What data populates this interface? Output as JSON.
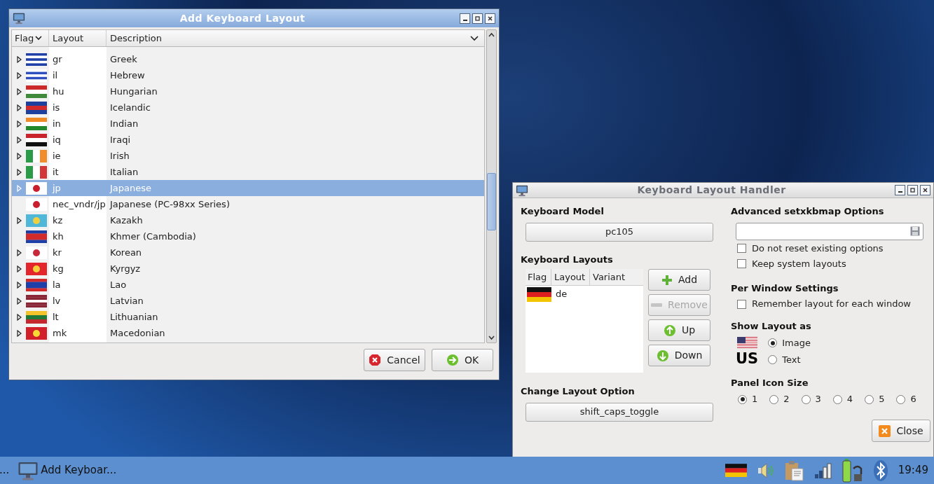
{
  "add_dialog": {
    "title": "Add Keyboard Layout",
    "columns": [
      "Flag",
      "Layout",
      "Description"
    ],
    "rows": [
      {
        "expandable": true,
        "selected": false,
        "layout": "gr",
        "description": "Greek",
        "flag": {
          "kind": "horizontal",
          "stripes": [
            {
              "color": "#1f3fa8"
            },
            {
              "color": "#ffffff"
            },
            {
              "color": "#1f3fa8"
            },
            {
              "color": "#ffffff"
            },
            {
              "color": "#1f3fa8"
            }
          ]
        }
      },
      {
        "expandable": true,
        "selected": false,
        "layout": "il",
        "description": "Hebrew",
        "flag": {
          "kind": "horizontal",
          "stripes": [
            {
              "color": "#ffffff"
            },
            {
              "color": "#2e4fbf"
            },
            {
              "color": "#ffffff"
            },
            {
              "color": "#2e4fbf"
            },
            {
              "color": "#ffffff"
            }
          ]
        }
      },
      {
        "expandable": true,
        "selected": false,
        "layout": "hu",
        "description": "Hungarian",
        "flag": {
          "kind": "horizontal",
          "stripes": [
            {
              "color": "#cc2a2a"
            },
            {
              "color": "#ffffff"
            },
            {
              "color": "#3f8a3a"
            }
          ]
        }
      },
      {
        "expandable": true,
        "selected": false,
        "layout": "is",
        "description": "Icelandic",
        "flag": {
          "kind": "horizontal",
          "stripes": [
            {
              "color": "#1d3f9e"
            },
            {
              "color": "#d22a2a"
            },
            {
              "color": "#1d3f9e"
            }
          ]
        }
      },
      {
        "expandable": true,
        "selected": false,
        "layout": "in",
        "description": "Indian",
        "flag": {
          "kind": "horizontal",
          "stripes": [
            {
              "color": "#f08a24"
            },
            {
              "color": "#ffffff"
            },
            {
              "color": "#23872c"
            }
          ]
        }
      },
      {
        "expandable": true,
        "selected": false,
        "layout": "iq",
        "description": "Iraqi",
        "flag": {
          "kind": "horizontal",
          "stripes": [
            {
              "color": "#c9242b"
            },
            {
              "color": "#ffffff"
            },
            {
              "color": "#111111"
            }
          ]
        }
      },
      {
        "expandable": true,
        "selected": false,
        "layout": "ie",
        "description": "Irish",
        "flag": {
          "kind": "vertical",
          "stripes": [
            {
              "color": "#2a9b46"
            },
            {
              "color": "#ffffff"
            },
            {
              "color": "#f28b2c"
            }
          ]
        }
      },
      {
        "expandable": true,
        "selected": false,
        "layout": "it",
        "description": "Italian",
        "flag": {
          "kind": "vertical",
          "stripes": [
            {
              "color": "#2a9b46"
            },
            {
              "color": "#ffffff"
            },
            {
              "color": "#d33636"
            }
          ]
        }
      },
      {
        "expandable": true,
        "selected": true,
        "layout": "jp",
        "description": "Japanese",
        "flag": {
          "kind": "disc",
          "stripes": [
            {
              "color": "#ffffff"
            },
            {
              "color": "#c81e2e"
            }
          ]
        }
      },
      {
        "expandable": false,
        "selected": false,
        "layout": "nec_vndr/jp",
        "description": "Japanese (PC-98xx Series)",
        "flag": {
          "kind": "disc",
          "stripes": [
            {
              "color": "#ffffff"
            },
            {
              "color": "#c81e2e"
            }
          ]
        }
      },
      {
        "expandable": true,
        "selected": false,
        "layout": "kz",
        "description": "Kazakh",
        "flag": {
          "kind": "disc",
          "stripes": [
            {
              "color": "#4fb8d8"
            },
            {
              "color": "#f0d040"
            }
          ]
        }
      },
      {
        "expandable": false,
        "selected": false,
        "layout": "kh",
        "description": "Khmer (Cambodia)",
        "flag": {
          "kind": "horizontal",
          "stripes": [
            {
              "color": "#1f3fa8"
            },
            {
              "color": "#d22a2a"
            },
            {
              "color": "#d22a2a"
            },
            {
              "color": "#1f3fa8"
            }
          ]
        }
      },
      {
        "expandable": true,
        "selected": false,
        "layout": "kr",
        "description": "Korean",
        "flag": {
          "kind": "disc",
          "stripes": [
            {
              "color": "#ffffff"
            },
            {
              "color": "#c8283a"
            }
          ]
        }
      },
      {
        "expandable": true,
        "selected": false,
        "layout": "kg",
        "description": "Kyrgyz",
        "flag": {
          "kind": "disc",
          "stripes": [
            {
              "color": "#e3262b"
            },
            {
              "color": "#f4d03a"
            }
          ]
        }
      },
      {
        "expandable": true,
        "selected": false,
        "layout": "la",
        "description": "Lao",
        "flag": {
          "kind": "horizontal",
          "stripes": [
            {
              "color": "#d22a2a"
            },
            {
              "color": "#1f3fa8"
            },
            {
              "color": "#1f3fa8"
            },
            {
              "color": "#d22a2a"
            }
          ]
        }
      },
      {
        "expandable": true,
        "selected": false,
        "layout": "lv",
        "description": "Latvian",
        "flag": {
          "kind": "horizontal",
          "stripes": [
            {
              "color": "#8a2535"
            },
            {
              "color": "#8a2535"
            },
            {
              "color": "#ffffff"
            },
            {
              "color": "#8a2535"
            },
            {
              "color": "#8a2535"
            }
          ]
        }
      },
      {
        "expandable": true,
        "selected": false,
        "layout": "lt",
        "description": "Lithuanian",
        "flag": {
          "kind": "horizontal",
          "stripes": [
            {
              "color": "#f4c22a"
            },
            {
              "color": "#1f7a3a"
            },
            {
              "color": "#c4282e"
            }
          ]
        }
      },
      {
        "expandable": true,
        "selected": false,
        "layout": "mk",
        "description": "Macedonian",
        "flag": {
          "kind": "disc",
          "stripes": [
            {
              "color": "#d2202a"
            },
            {
              "color": "#f6d935"
            }
          ]
        }
      }
    ],
    "buttons": [
      {
        "kind": "cancel",
        "label": "Cancel"
      },
      {
        "kind": "ok",
        "label": "OK"
      }
    ]
  },
  "handler": {
    "title": "Keyboard Layout Handler",
    "keyboard_model": {
      "heading": "Keyboard Model",
      "value": "pc105"
    },
    "layouts": {
      "heading": "Keyboard Layouts",
      "columns": [
        "Flag",
        "Layout",
        "Variant"
      ],
      "rows": [
        {
          "layout": "de",
          "flag": {
            "kind": "horizontal",
            "stripes": [
              {
                "color": "#111111"
              },
              {
                "color": "#dd1f1f"
              },
              {
                "color": "#f5c400"
              }
            ]
          }
        }
      ],
      "buttons": [
        {
          "kind": "add",
          "label": "Add",
          "disabled": false
        },
        {
          "kind": "remove",
          "label": "Remove",
          "disabled": true
        },
        {
          "kind": "up",
          "label": "Up",
          "disabled": false
        },
        {
          "kind": "down",
          "label": "Down",
          "disabled": false
        }
      ]
    },
    "change_option": {
      "heading": "Change Layout Option",
      "value": "shift_caps_toggle"
    },
    "advanced": {
      "heading": "Advanced setxkbmap Options",
      "options": [
        {
          "label": "Do not reset existing options",
          "checked": false
        },
        {
          "label": "Keep system layouts",
          "checked": false
        }
      ]
    },
    "per_window": {
      "heading": "Per Window Settings",
      "options": [
        {
          "label": "Remember layout for each window",
          "checked": false
        }
      ]
    },
    "show_layout": {
      "heading": "Show Layout as",
      "preview_text": "US",
      "options": [
        {
          "label": "Image",
          "selected": true
        },
        {
          "label": "Text",
          "selected": false
        }
      ]
    },
    "icon_size": {
      "heading": "Panel Icon Size",
      "options": [
        {
          "label": "1",
          "selected": true
        },
        {
          "label": "2",
          "selected": false
        },
        {
          "label": "3",
          "selected": false
        },
        {
          "label": "4",
          "selected": false
        },
        {
          "label": "5",
          "selected": false
        },
        {
          "label": "6",
          "selected": false
        }
      ]
    },
    "close": "Close"
  },
  "taskbar": {
    "cut_item": "...",
    "task": "Add Keyboar...",
    "tray_flag": {
      "kind": "horizontal",
      "stripes": [
        {
          "color": "#111111"
        },
        {
          "color": "#dd1f1f"
        },
        {
          "color": "#f5c400"
        }
      ]
    },
    "clock": "19:49"
  }
}
